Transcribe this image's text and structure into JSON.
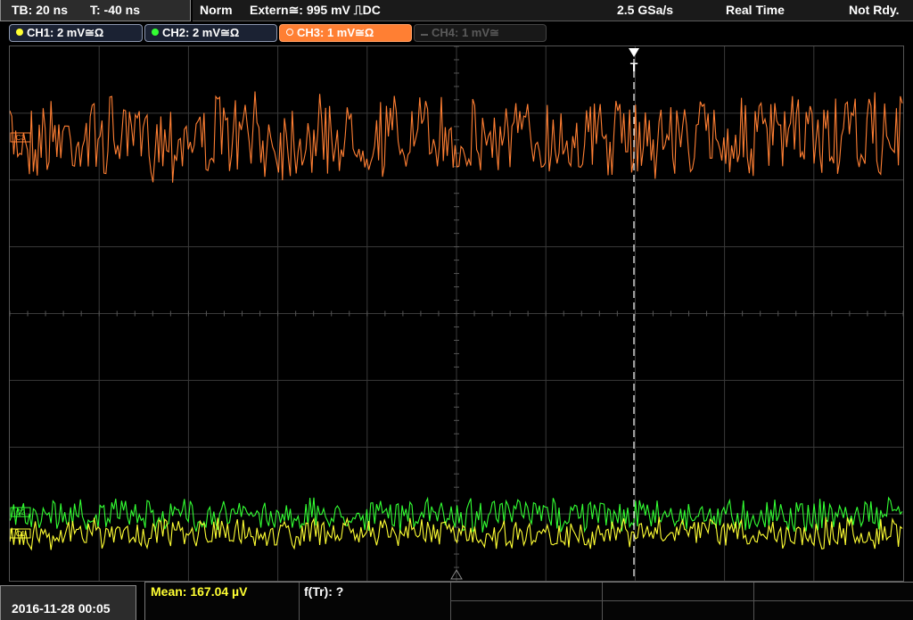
{
  "timebase": {
    "tb": "TB: 20 ns",
    "trigger_pos": "T: -40 ns"
  },
  "status": {
    "mode": "Norm",
    "trigger": "Extern≅: 995 mV ⎍DC",
    "sample_rate": "2.5 GSa/s",
    "acquisition": "Real Time",
    "state": "Not Rdy."
  },
  "channels": [
    {
      "label": "CH1: 2 mV≅Ω",
      "color": "#ffff33",
      "active": true
    },
    {
      "label": "CH2: 2 mV≅Ω",
      "color": "#33ff33",
      "active": true
    },
    {
      "label": "CH3: 1 mV≅Ω",
      "color": "#ff7f33",
      "active": true
    },
    {
      "label": "CH4: 1 mV≅",
      "color": "#5a5a5a",
      "active": false
    }
  ],
  "markers": {
    "trigger": "T",
    "ch3": "C3",
    "ch2": "C2",
    "ch1": "C1"
  },
  "footer": {
    "datetime": "2016-11-28 00:05",
    "measurements": [
      {
        "text": "Mean: 167.04 µV",
        "color": "#ffff33"
      },
      {
        "text": "f(Tr): ?",
        "color": "#ffffff"
      }
    ]
  }
}
